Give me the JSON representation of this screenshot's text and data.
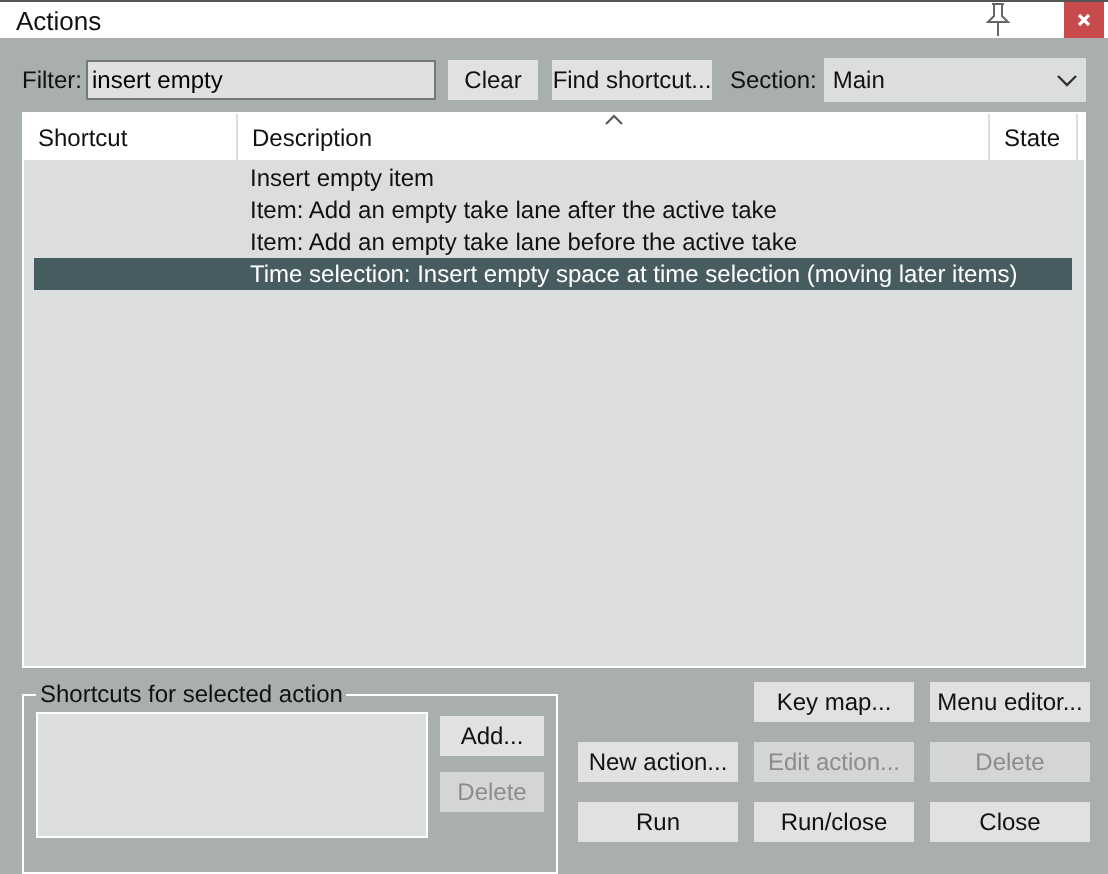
{
  "window": {
    "title": "Actions"
  },
  "filter": {
    "label": "Filter:",
    "value": "insert empty"
  },
  "filter_buttons": [
    {
      "label": "Clear",
      "disabled": false
    },
    {
      "label": "Find shortcut...",
      "disabled": false
    }
  ],
  "section": {
    "label": "Section:",
    "value": "Main"
  },
  "table": {
    "columns": [
      {
        "label": "Shortcut",
        "sorted": false
      },
      {
        "label": "Description",
        "sorted": true
      },
      {
        "label": "State",
        "sorted": false
      }
    ],
    "rows": [
      {
        "description": "Insert empty item",
        "selected": false
      },
      {
        "description": "Item: Add an empty take lane after the active take",
        "selected": false
      },
      {
        "description": "Item: Add an empty take lane before the active take",
        "selected": false
      },
      {
        "description": "Time selection: Insert empty space at time selection (moving later items)",
        "selected": true
      }
    ]
  },
  "shortcuts_group": {
    "title": "Shortcuts for selected action",
    "buttons": [
      {
        "label": "Add...",
        "disabled": false
      },
      {
        "label": "Delete",
        "disabled": true
      }
    ]
  },
  "action_buttons": [
    [
      {
        "label": "Key map...",
        "disabled": false
      },
      {
        "label": "Menu editor...",
        "disabled": false
      }
    ],
    [
      {
        "label": "New action...",
        "disabled": false
      },
      {
        "label": "Edit action...",
        "disabled": true
      },
      {
        "label": "Delete",
        "disabled": true
      }
    ],
    [
      {
        "label": "Run",
        "disabled": false
      },
      {
        "label": "Run/close",
        "disabled": false
      },
      {
        "label": "Close",
        "disabled": false
      }
    ]
  ]
}
